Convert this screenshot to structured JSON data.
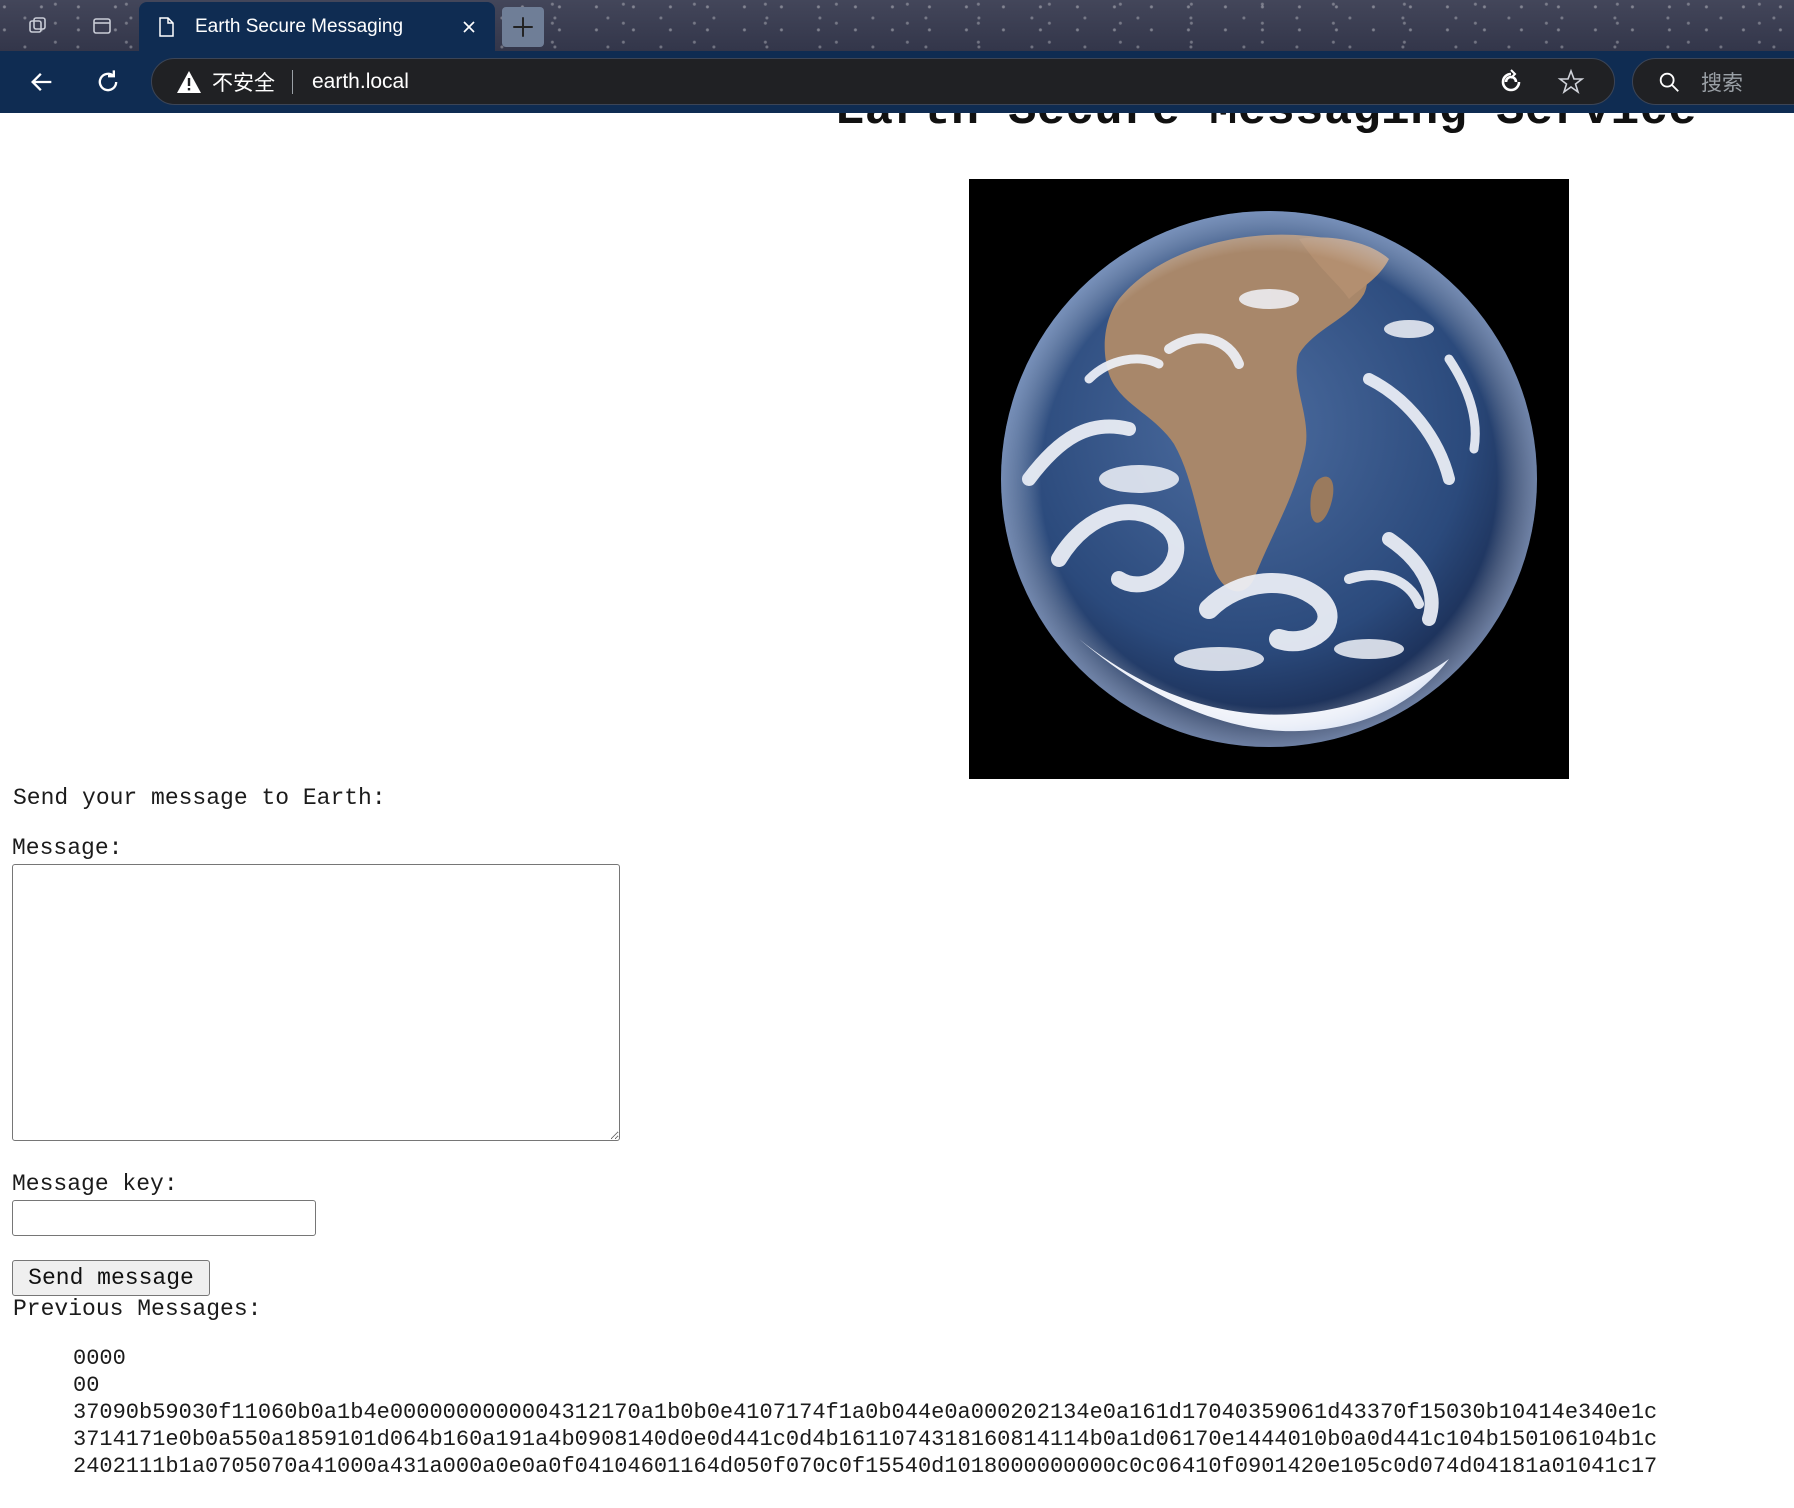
{
  "browser": {
    "tab": {
      "title": "Earth Secure Messaging",
      "icon": "page-icon",
      "close_icon": "close-icon"
    },
    "new_tab_icon": "plus-icon",
    "toolbar": {
      "back_icon": "back-arrow-icon",
      "refresh_icon": "refresh-icon",
      "security_label": "不安全",
      "url": "earth.local",
      "search_placeholder": "搜索"
    }
  },
  "page": {
    "heading": "Earth Secure Messaging Service",
    "image": "earth-photo",
    "form": {
      "intro": "Send your message to Earth:",
      "message_label": "Message:",
      "message_value": "",
      "key_label": "Message key:",
      "key_value": "",
      "submit_label": "Send message"
    },
    "previous_heading": "Previous Messages:",
    "previous_messages": [
      "0000",
      "00",
      "37090b59030f11060b0a1b4e0000000000004312170a1b0b0e4107174f1a0b044e0a000202134e0a161d17040359061d43370f15030b10414e340e1c",
      "3714171e0b0a550a1859101d064b160a191a4b0908140d0e0d441c0d4b1611074318160814114b0a1d06170e1444010b0a0d441c104b150106104b1c",
      "2402111b1a0705070a41000a431a000a0e0a0f04104601164d050f070c0f15540d1018000000000c0c06410f0901420e105c0d074d04181a01041c17"
    ]
  },
  "colors": {
    "chrome_dark": "#0f2c52",
    "omnibox": "#202124",
    "tab_strip": "#3a3c4e"
  }
}
